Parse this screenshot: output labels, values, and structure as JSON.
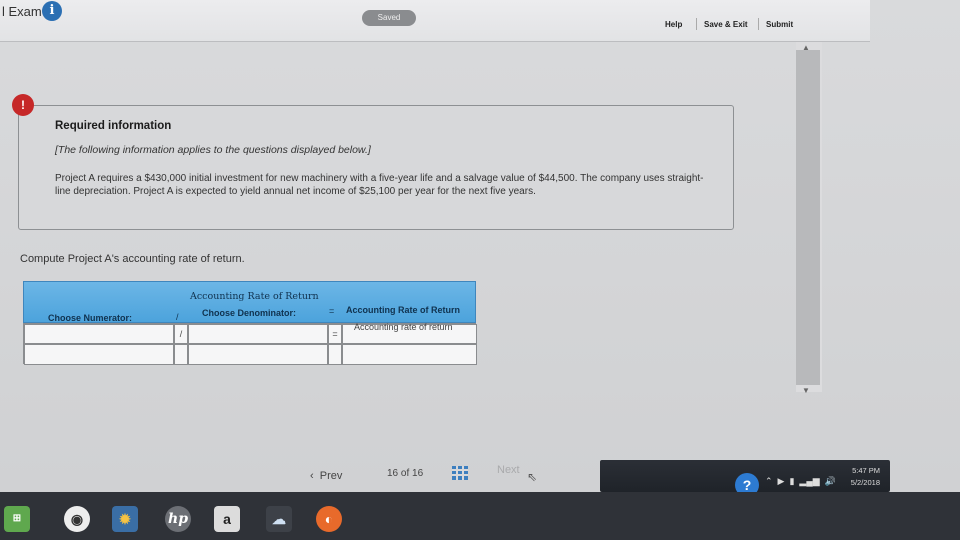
{
  "header": {
    "exam_title": "l Exam",
    "info_icon": "info-icon",
    "saved_label": "Saved",
    "help_label": "Help",
    "save_exit_label": "Save & Exit",
    "submit_label": "Submit"
  },
  "info_box": {
    "alert_glyph": "!",
    "title": "Required information",
    "subtitle": "[The following information applies to the questions displayed below.]",
    "body": "Project A requires a $430,000 initial investment for new machinery with a five-year life and a salvage value of $44,500. The company uses straight-line depreciation. Project A is expected to yield annual net income of $25,100 per year for the next five years."
  },
  "question": "Compute Project A's accounting rate of return.",
  "table": {
    "title": "Accounting Rate of Return",
    "numerator_label": "Choose Numerator:",
    "divide_op": "/",
    "denominator_label": "Choose Denominator:",
    "equals_op": "=",
    "result_label": "Accounting Rate of Return",
    "result_hint": "Accounting rate of return",
    "row_divide_op": "/",
    "row_equals_op": "="
  },
  "pager": {
    "prev_label": "Prev",
    "page_current": "16",
    "page_of": "of",
    "page_total": "16",
    "next_label": "Next"
  },
  "system": {
    "time": "5:47 PM",
    "date": "5/2/2018",
    "help_glyph": "?"
  },
  "taskbar": {
    "hp_label": "hp",
    "amazon_label": "a"
  }
}
